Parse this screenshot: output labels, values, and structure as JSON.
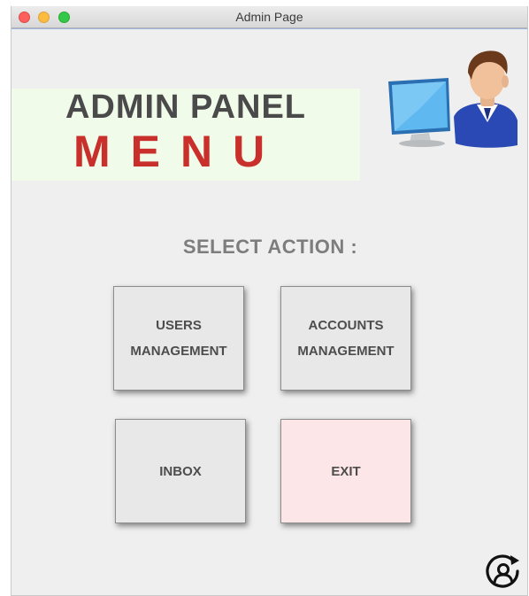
{
  "window": {
    "title": "Admin Page"
  },
  "banner": {
    "title": "ADMIN PANEL",
    "menu": "MENU"
  },
  "avatar_icon": "admin-user-computer-icon",
  "select_label": "SELECT ACTION :",
  "actions": [
    {
      "line1": "USERS",
      "line2": "MANAGEMENT"
    },
    {
      "line1": "ACCOUNTS",
      "line2": "MANAGEMENT"
    },
    {
      "label": "INBOX"
    },
    {
      "label": "EXIT"
    }
  ],
  "footer_icon": "account-switch-icon",
  "colors": {
    "menu_red": "#c9302c",
    "banner_bg": "#f0fbe9",
    "exit_bg": "#fde6e7",
    "button_bg": "#e8e8e8",
    "window_bg": "#efefef"
  }
}
